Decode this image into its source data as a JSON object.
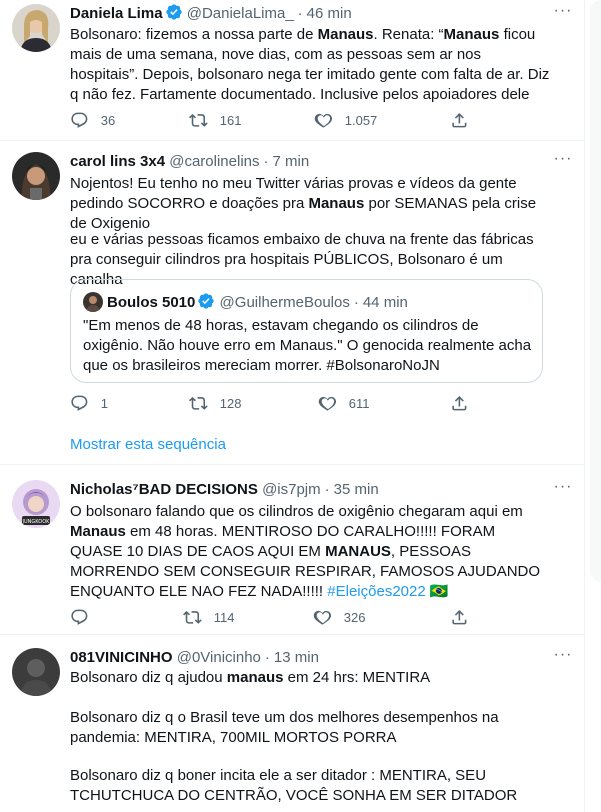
{
  "tweets": [
    {
      "name": "Daniela Lima",
      "handle": "@DanielaLima_",
      "time": "46 min",
      "text_parts": [
        "Bolsonaro: fizemos a nossa parte de ",
        "Manaus",
        ". Renata: “",
        "Manaus",
        " ficou mais de uma semana, nove dias, com as pessoas sem ar nos hospitais”. Depois, bolsonaro nega ter imitado gente com falta de ar. Diz q não fez. Fartamente documentado. Inclusive pelos apoiadores dele"
      ],
      "replies": "36",
      "retweets": "161",
      "likes": "1.057"
    },
    {
      "name": "carol lins 3x4",
      "handle": "@carolinelins",
      "time": "7 min",
      "text_p1": [
        "Nojentos! Eu tenho no meu Twitter várias provas e vídeos da gente pedindo SOCORRO e doações pra ",
        "Manaus",
        " por SEMANAS pela crise de Oxigenio"
      ],
      "text_p2": "eu e várias pessoas ficamos embaixo de chuva na frente das fábricas pra conseguir cilindros pra hospitais PÚBLICOS, Bolsonaro é um canalha",
      "quote": {
        "name": "Boulos 5010",
        "handle": "@GuilhermeBoulos",
        "time": "44 min",
        "text": "\"Em menos de 48 horas, estavam chegando os cilindros de oxigênio. Não houve erro em Manaus.\" O genocida realmente acha que os brasileiros mereciam morrer. #BolsonaroNoJN"
      },
      "replies": "1",
      "retweets": "128",
      "likes": "611",
      "show_more": "Mostrar esta sequência"
    },
    {
      "name": "Nicholas⁷BAD DECISIONS",
      "handle": "@is7pjm",
      "time": "35 min",
      "text_parts": [
        "O bolsonaro falando que os cilindros de oxigênio chegaram aqui em ",
        "Manaus",
        " em 48 horas. MENTIROSO DO CARALHO!!!!! FORAM QUASE 10 DIAS DE CAOS AQUI EM ",
        "MANAUS",
        ", PESSOAS MORRENDO SEM CONSEGUIR RESPIRAR, FAMOSOS AJUDANDO ENQUANTO ELE NAO FEZ NADA!!!!! "
      ],
      "hashtag": "#Eleições2022",
      "emoji": "🇧🇷",
      "replies": "",
      "retweets": "114",
      "likes": "326"
    },
    {
      "name": "081VINICINHO",
      "handle": "@0Vinicinho",
      "time": "13 min",
      "text_p1": [
        "Bolsonaro diz q ajudou ",
        "manaus",
        " em 24 hrs: MENTIRA"
      ],
      "text_p2": "Bolsonaro diz q o Brasil teve um dos melhores desempenhos na pandemia: MENTIRA, 700MIL MORTOS PORRA",
      "text_p3": "Bolsonaro diz q boner incita ele a ser ditador : MENTIRA, SEU TCHUTCHUCA DO CENTRÃO, VOCÊ SONHA EM SER DITADOR"
    }
  ],
  "colors": {
    "accent": "#1d9bf0",
    "secondary_text": "#536471",
    "border": "#eff3f4"
  },
  "icons": [
    "verified-badge-icon",
    "reply-icon",
    "retweet-icon",
    "like-icon",
    "share-icon",
    "more-icon"
  ]
}
